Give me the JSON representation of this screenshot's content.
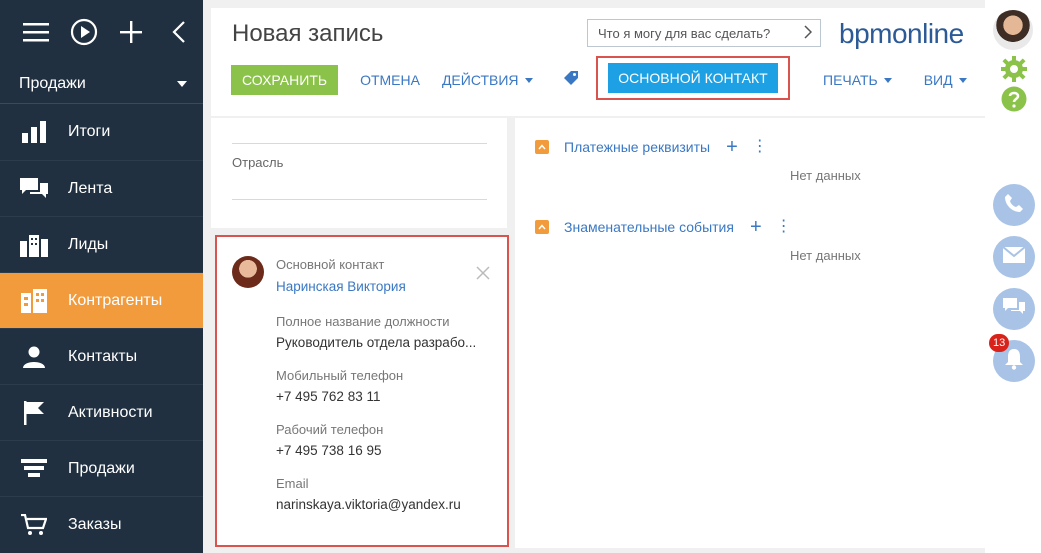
{
  "sidebar": {
    "section": "Продажи",
    "items": [
      {
        "label": "Итоги",
        "icon": "bar-chart-icon"
      },
      {
        "label": "Лента",
        "icon": "chat-icon"
      },
      {
        "label": "Лиды",
        "icon": "leads-icon"
      },
      {
        "label": "Контрагенты",
        "icon": "building-icon",
        "active": true
      },
      {
        "label": "Контакты",
        "icon": "person-icon"
      },
      {
        "label": "Активности",
        "icon": "flag-icon"
      },
      {
        "label": "Продажи",
        "icon": "funnel-icon"
      },
      {
        "label": "Заказы",
        "icon": "cart-icon"
      }
    ]
  },
  "header": {
    "title": "Новая запись",
    "search_placeholder": "Что я могу для вас сделать?",
    "logo_a": "bpm",
    "logo_b": "online"
  },
  "toolbar": {
    "save": "СОХРАНИТЬ",
    "cancel": "ОТМЕНА",
    "actions": "ДЕЙСТВИЯ",
    "main_contact": "ОСНОВНОЙ КОНТАКТ",
    "print": "ПЕЧАТЬ",
    "view": "ВИД"
  },
  "left_panel": {
    "industry_label": "Отрасль"
  },
  "contact_card": {
    "header_label": "Основной контакт",
    "name": "Наринская Виктория",
    "fields": [
      {
        "label": "Полное название должности",
        "value": "Руководитель отдела разрабо..."
      },
      {
        "label": "Мобильный телефон",
        "value": "+7 495 762 83 11"
      },
      {
        "label": "Рабочий телефон",
        "value": "+7 495 738 16 95"
      },
      {
        "label": "Email",
        "value": "narinskaya.viktoria@yandex.ru"
      }
    ]
  },
  "details": {
    "groups": [
      {
        "title": "Платежные реквизиты",
        "empty": "Нет данных"
      },
      {
        "title": "Знаменательные события",
        "empty": "Нет данных"
      }
    ]
  },
  "rail": {
    "notifications_count": "13"
  },
  "colors": {
    "sidebar_bg": "#203040",
    "active_item": "#f29b3c",
    "save_button": "#8bc34a",
    "main_contact_button": "#1da1e4",
    "highlight_border": "#d9534f",
    "link": "#3a78c3"
  }
}
